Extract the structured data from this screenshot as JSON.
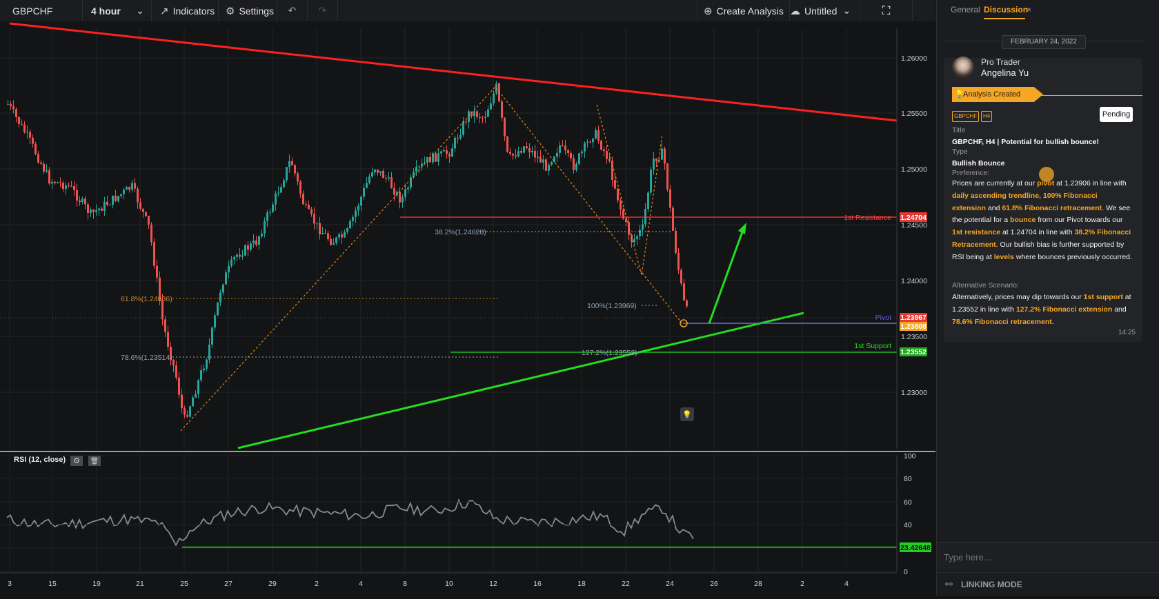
{
  "toolbar": {
    "symbol": "GBPCHF",
    "timeframe": "4 hour",
    "indicators_label": "Indicators",
    "settings_label": "Settings",
    "create_analysis_label": "Create Analysis",
    "layout_name": "Untitled"
  },
  "chart": {
    "price_ticks": [
      "1.26000",
      "1.25500",
      "1.25000",
      "1.24500",
      "1.24000",
      "1.23500",
      "1.23000"
    ],
    "x_ticks": [
      "3",
      "15",
      "19",
      "21",
      "25",
      "27",
      "29",
      "2",
      "4",
      "8",
      "10",
      "12",
      "16",
      "18",
      "22",
      "24",
      "26",
      "28",
      "2",
      "4"
    ],
    "levels": {
      "resistance_label": "1st Resistance",
      "resistance_price": "1.24704",
      "pivot_label": "Pivot",
      "pivot_price": "1.23808",
      "current_price": "1.23867",
      "support_label": "1st Support",
      "support_price": "1.23552"
    },
    "fib_labels": {
      "fib_382": "38.2%(1.24628)",
      "fib_618": "61.8%(1.24036)",
      "fib_100": "100%(1.23969)",
      "fib_786": "78.6%(1.23514)",
      "fib_1272": "127.2%(1.23553)"
    }
  },
  "rsi": {
    "title": "RSI (12, close)",
    "ticks": [
      "100",
      "80",
      "60",
      "40",
      "20",
      "0"
    ],
    "value": "23.42648"
  },
  "panel": {
    "tab_general": "General",
    "tab_discussion": "Discussion",
    "close_glyph": "×",
    "date": "FEBRUARY 24, 2022",
    "author_role": "Pro Trader",
    "author_name": "Angelina Yu",
    "banner": "Analysis Created",
    "tag_symbol": "GBPCHF",
    "tag_tf": "H4",
    "status": "Pending",
    "title_label": "Title",
    "title_value": "GBPCHF, H4 | Potential for bullish bounce!",
    "type_label": "Type",
    "type_value": "Bullish Bounce",
    "preference_label": "Preference:",
    "pref": {
      "t1": "Prices are currently at our ",
      "h1": "pivot",
      "t2": " at 1.23906 in line with ",
      "h2": "daily ascending trendline, 100% Fibonacci extension",
      "t3": " and ",
      "h3": "61.8% Fibonacci retracement",
      "t4": ". We see the potential for a ",
      "h4": "bounce",
      "t5": " from our Pivot towards our ",
      "h5": "1st resistance",
      "t6": " at 1.24704 in line with ",
      "h6": "38.2% Fibonacci Retracement",
      "t7": ". Our bullish bias is further supported by RSI being at ",
      "h7": "levels",
      "t8": " where bounces previously occurred."
    },
    "alt_label": "Alternative Scenario:",
    "alt": {
      "t1": "Alternatively, prices may dip towards our ",
      "h1": "1st support",
      "t2": " at 1.23552 in line with ",
      "h2": "127.2% Fibonacci extension",
      "t3": " and ",
      "h3": "78.6% Fibonacci retracement",
      "t4": "."
    },
    "time": "14:25",
    "input_placeholder": "Type here...",
    "linking_mode": "LINKING MODE"
  },
  "colors": {
    "accent": "#f5a623",
    "resistance": "#ff3b3b",
    "support": "#22dd22",
    "pivot": "#7b68ee",
    "up_candle": "#26a69a",
    "down_candle": "#ef5350"
  }
}
